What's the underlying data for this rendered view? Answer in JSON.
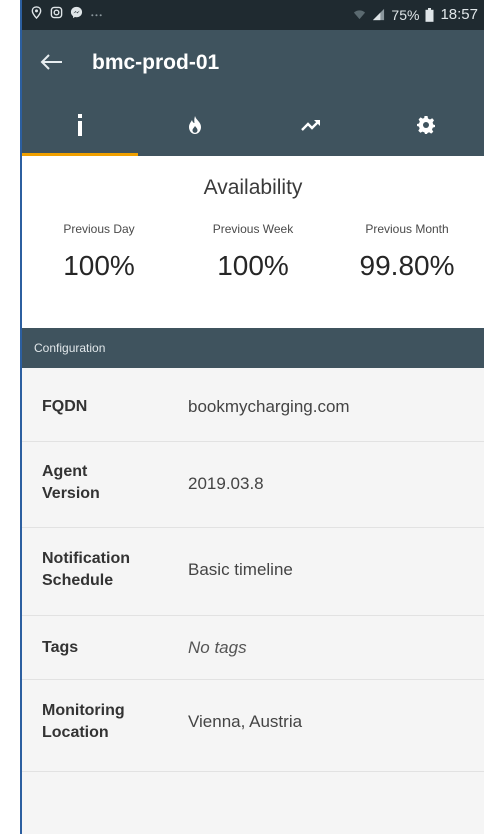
{
  "status_bar": {
    "battery": "75%",
    "time": "18:57",
    "icons": [
      "location-icon",
      "instagram-icon",
      "messenger-icon",
      "more-dots-icon",
      "wifi-icon",
      "signal-icon",
      "battery-icon"
    ]
  },
  "app_bar": {
    "title": "bmc-prod-01",
    "back_icon": "arrow-back-icon"
  },
  "tabs": [
    {
      "icon": "info-icon",
      "active": true
    },
    {
      "icon": "flame-icon",
      "active": false
    },
    {
      "icon": "trending-up-icon",
      "active": false
    },
    {
      "icon": "gear-icon",
      "active": false
    }
  ],
  "availability": {
    "title": "Availability",
    "columns": [
      {
        "label": "Previous Day",
        "value": "100%"
      },
      {
        "label": "Previous Week",
        "value": "100%"
      },
      {
        "label": "Previous Month",
        "value": "99.80%"
      }
    ]
  },
  "configuration": {
    "header": "Configuration",
    "rows": [
      {
        "key": "FQDN",
        "value": "bookmycharging.com"
      },
      {
        "key": "Agent Version",
        "value": "2019.03.8"
      },
      {
        "key": "Notification Schedule",
        "value": "Basic timeline"
      },
      {
        "key": "Tags",
        "value": "No tags"
      },
      {
        "key": "Monitoring Location",
        "value": "Vienna, Austria"
      }
    ]
  },
  "colors": {
    "toolbar": "#3f535e",
    "status_bar": "#1f2a30",
    "tab_indicator": "#f0a000"
  }
}
